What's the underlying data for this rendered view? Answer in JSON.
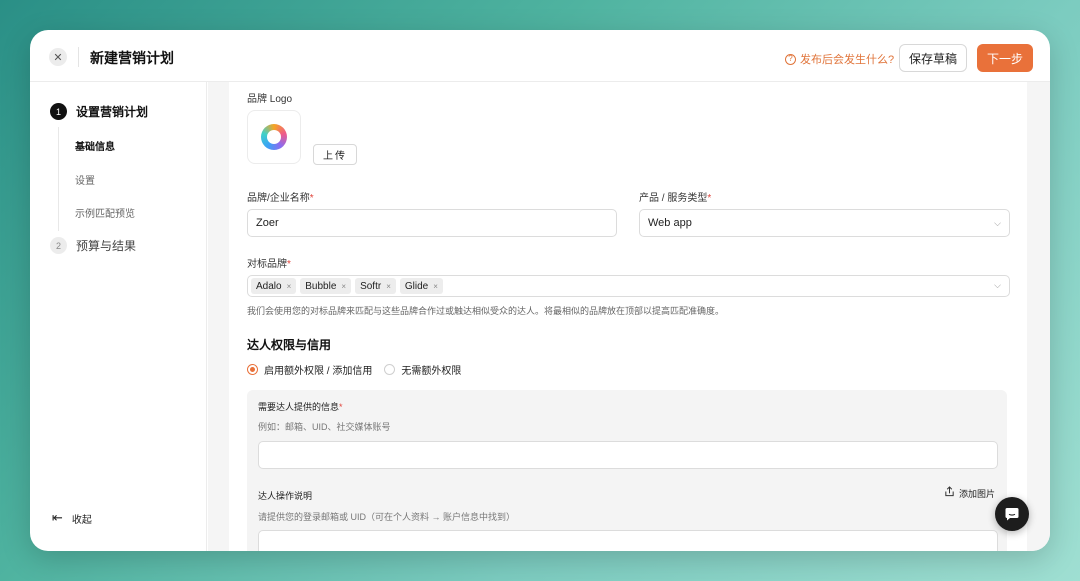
{
  "header": {
    "close_glyph": "✕",
    "title": "新建营销计划",
    "hint_icon": "?",
    "hint_text": "发布后会发生什么?",
    "save_draft_label": "保存草稿",
    "next_label": "下一步"
  },
  "sidebar": {
    "steps": [
      {
        "num": "1",
        "label": "设置营销计划",
        "state": "active"
      },
      {
        "num": "2",
        "label": "预算与结果",
        "state": "inactive"
      }
    ],
    "substeps": [
      {
        "label": "基础信息",
        "current": true
      },
      {
        "label": "设置",
        "current": false
      },
      {
        "label": "示例匹配预览",
        "current": false
      }
    ],
    "collapse_icon": "⇤",
    "collapse_label": "收起"
  },
  "form": {
    "logo_label": "品牌 Logo",
    "upload_label": "上传",
    "brand_name_label": "品牌/企业名称",
    "brand_name_value": "Zoer",
    "product_type_label": "产品 / 服务类型",
    "product_type_value": "Web app",
    "benchmark_label": "对标品牌",
    "benchmark_tags": [
      "Adalo",
      "Bubble",
      "Softr",
      "Glide"
    ],
    "benchmark_help": "我们会使用您的对标品牌来匹配与这些品牌合作过或触达相似受众的达人。将最相似的品牌放在顶部以提高匹配准确度。",
    "required_mark": "*",
    "chevron": "⌵",
    "tag_remove": "×"
  },
  "creator": {
    "section_title": "达人权限与信用",
    "options": [
      {
        "label": "启用额外权限 / 添加信用",
        "checked": true
      },
      {
        "label": "无需额外权限",
        "checked": false
      }
    ],
    "info_label": "需要达人提供的信息",
    "info_placeholder": "例如：邮箱、UID、社交媒体账号",
    "instructions_label": "达人操作说明",
    "add_image_label": "添加图片",
    "instructions_placeholder": "请提供您的登录邮箱或 UID（可在个人资料 → 账户信息中找到）"
  },
  "colors": {
    "accent": "#e9713a",
    "required": "#e0433a"
  },
  "icons": {
    "close": "close-icon",
    "help": "help-circle-icon",
    "collapse": "collapse-left-icon",
    "chevron": "chevron-down-icon",
    "add_image": "share-upload-icon",
    "chat": "chat-bubble-icon"
  }
}
